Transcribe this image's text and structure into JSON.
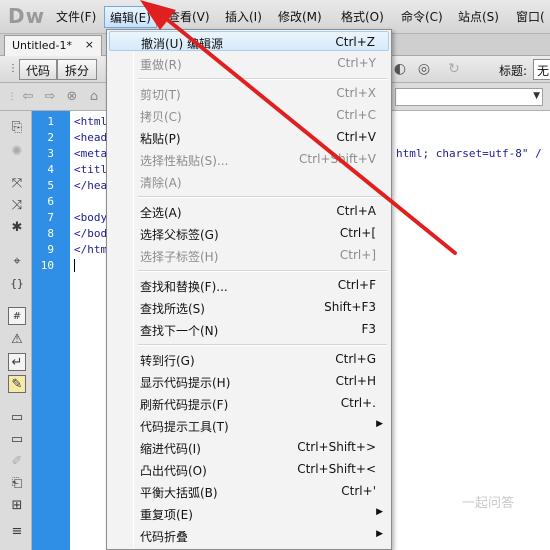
{
  "app": {
    "logo": "Dw"
  },
  "menubar": {
    "file": "文件(F)",
    "edit": "编辑(E)",
    "view": "查看(V)",
    "insert": "插入(I)",
    "modify": "修改(M)",
    "format": "格式(O)",
    "commands": "命令(C)",
    "site": "站点(S)",
    "window": "窗口("
  },
  "document_tab": {
    "name": "Untitled-1*",
    "close": "×"
  },
  "toolbar": {
    "code_view": "代码",
    "split_view": "拆分",
    "title_label": "标题:",
    "title_value": "无"
  },
  "line_numbers": [
    "1",
    "2",
    "3",
    "4",
    "5",
    "6",
    "7",
    "8",
    "9",
    "10"
  ],
  "code_lines": [
    "<html",
    "<head",
    "<meta",
    "<titl",
    "</hea",
    "",
    "<body",
    "</bod",
    "</htm",
    ""
  ],
  "code_overflow": "html; charset=utf-8\" /",
  "edit_menu": {
    "undo": {
      "label": "撤消(U) 编辑源",
      "shortcut": "Ctrl+Z"
    },
    "redo": {
      "label": "重做(R)",
      "shortcut": "Ctrl+Y"
    },
    "cut": {
      "label": "剪切(T)",
      "shortcut": "Ctrl+X"
    },
    "copy": {
      "label": "拷贝(C)",
      "shortcut": "Ctrl+C"
    },
    "paste": {
      "label": "粘贴(P)",
      "shortcut": "Ctrl+V"
    },
    "paste_special": {
      "label": "选择性粘贴(S)...",
      "shortcut": "Ctrl+Shift+V"
    },
    "clear": {
      "label": "清除(A)",
      "shortcut": ""
    },
    "select_all": {
      "label": "全选(A)",
      "shortcut": "Ctrl+A"
    },
    "select_parent": {
      "label": "选择父标签(G)",
      "shortcut": "Ctrl+["
    },
    "select_child": {
      "label": "选择子标签(H)",
      "shortcut": "Ctrl+]"
    },
    "find_replace": {
      "label": "查找和替换(F)...",
      "shortcut": "Ctrl+F"
    },
    "find_selection": {
      "label": "查找所选(S)",
      "shortcut": "Shift+F3"
    },
    "find_next": {
      "label": "查找下一个(N)",
      "shortcut": "F3"
    },
    "goto_line": {
      "label": "转到行(G)",
      "shortcut": "Ctrl+G"
    },
    "show_hints": {
      "label": "显示代码提示(H)",
      "shortcut": "Ctrl+H"
    },
    "refresh_hints": {
      "label": "刷新代码提示(F)",
      "shortcut": "Ctrl+."
    },
    "hint_tools": {
      "label": "代码提示工具(T)",
      "shortcut": ""
    },
    "indent": {
      "label": "缩进代码(I)",
      "shortcut": "Ctrl+Shift+>"
    },
    "outdent": {
      "label": "凸出代码(O)",
      "shortcut": "Ctrl+Shift+<"
    },
    "balance_braces": {
      "label": "平衡大括弧(B)",
      "shortcut": "Ctrl+'"
    },
    "repeat_items": {
      "label": "重复项(E)",
      "shortcut": ""
    },
    "code_folding": {
      "label": "代码折叠",
      "shortcut": ""
    }
  },
  "watermark": "一起问答",
  "colors": {
    "gutter": "#2f8fe6",
    "annotation": "#e02020",
    "code_text": "#1d1d90"
  }
}
